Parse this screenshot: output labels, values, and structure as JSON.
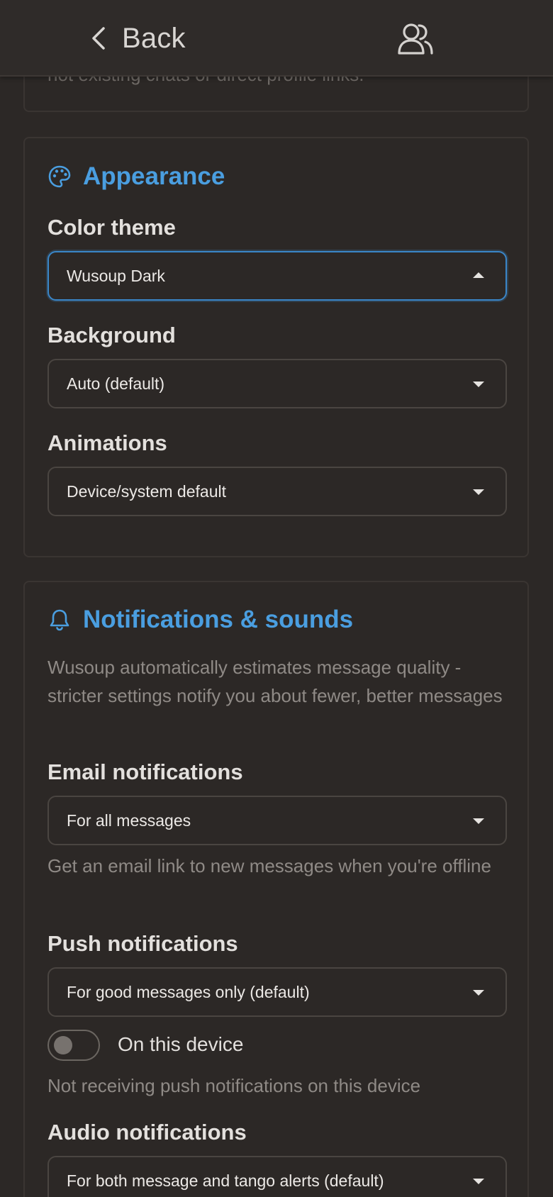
{
  "header": {
    "back_label": "Back",
    "contacts_icon": "people-icon"
  },
  "prev_section": {
    "trailing_text": "not existing chats or direct profile links."
  },
  "appearance": {
    "title": "Appearance",
    "icon": "palette-icon",
    "accent_color": "#4a9ee0",
    "color_theme": {
      "label": "Color theme",
      "value": "Wusoup Dark",
      "open": true
    },
    "background": {
      "label": "Background",
      "value": "Auto (default)"
    },
    "animations": {
      "label": "Animations",
      "value": "Device/system default"
    }
  },
  "notifications": {
    "title": "Notifications & sounds",
    "icon": "bell-icon",
    "description": "Wusoup automatically estimates message quality - stricter settings notify you about fewer, better messages",
    "email": {
      "label": "Email notifications",
      "value": "For all messages",
      "help": "Get an email link to new messages when you're offline"
    },
    "push": {
      "label": "Push notifications",
      "value": "For good messages only (default)",
      "device_toggle_label": "On this device",
      "device_toggle_on": false,
      "status": "Not receiving push notifications on this device"
    },
    "audio": {
      "label": "Audio notifications",
      "value": "For both message and tango alerts (default)"
    }
  }
}
